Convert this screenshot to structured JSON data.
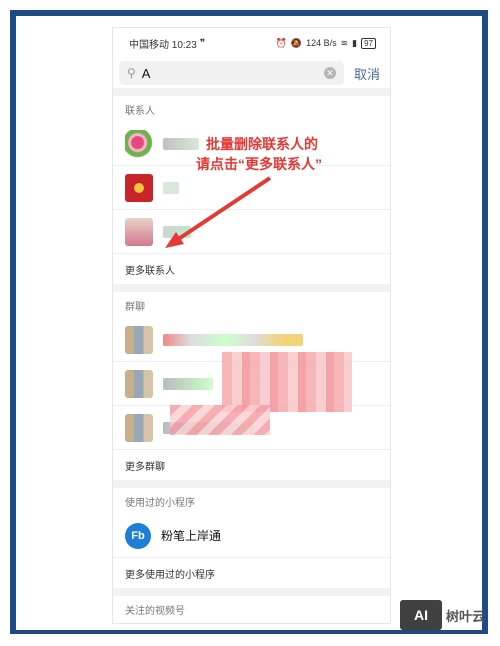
{
  "status_bar": {
    "carrier_time": "中国移动 10:23",
    "net_speed": "124 B/s",
    "battery": "97"
  },
  "search": {
    "value": "A",
    "cancel_label": "取消"
  },
  "sections": {
    "contacts": {
      "title": "联系人",
      "more": "更多联系人"
    },
    "groups": {
      "title": "群聊",
      "more": "更多群聊"
    },
    "miniprograms": {
      "title": "使用过的小程序",
      "item": "粉笔上岸通",
      "more": "更多使用过的小程序"
    },
    "channels": {
      "title": "关注的视频号"
    }
  },
  "app_icon_text": "Fb",
  "annotation": {
    "line1": "批量删除联系人的",
    "line2": "请点击“更多联系人”"
  },
  "watermark": {
    "logo": "AI",
    "text": "树叶云"
  },
  "colors": {
    "frame": "#1e4a86",
    "annotation": "#e53935",
    "app_icon": "#1f7fd8"
  }
}
